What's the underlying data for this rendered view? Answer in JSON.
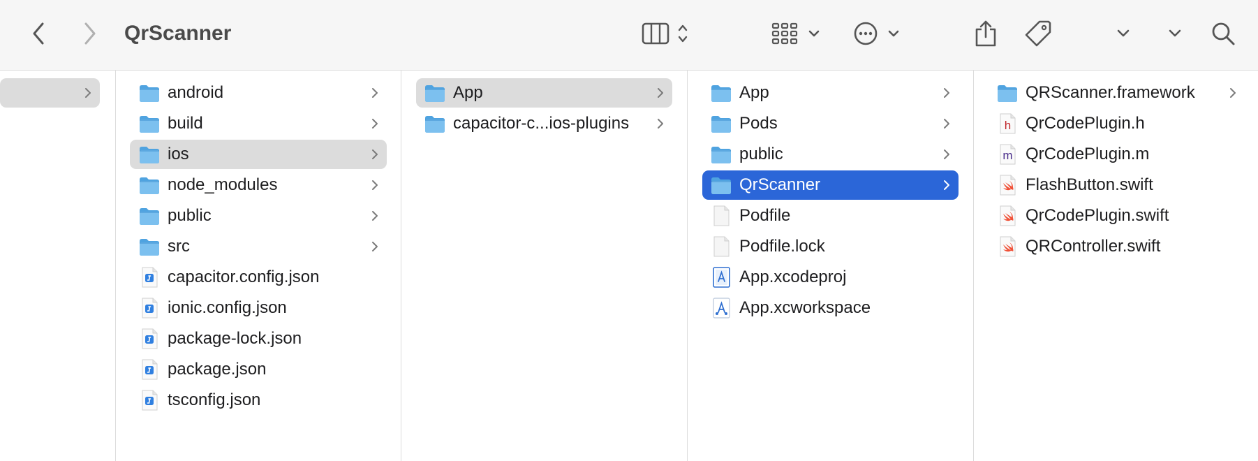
{
  "window": {
    "title": "QrScanner"
  },
  "toolbar": {
    "buttons": [
      {
        "name": "back-button",
        "icon": "chevron-left-icon"
      },
      {
        "name": "forward-button",
        "icon": "chevron-right-icon"
      },
      {
        "name": "view-columns-button",
        "icon": "columns-icon"
      },
      {
        "name": "group-button",
        "icon": "grid-icon"
      },
      {
        "name": "more-actions-button",
        "icon": "ellipsis-circle-icon"
      },
      {
        "name": "share-button",
        "icon": "share-icon"
      },
      {
        "name": "tags-button",
        "icon": "tag-icon"
      },
      {
        "name": "dropdown-button-1",
        "icon": "chevron-down-icon"
      },
      {
        "name": "dropdown-button-2",
        "icon": "chevron-down-icon"
      },
      {
        "name": "search-button",
        "icon": "search-icon"
      }
    ]
  },
  "columns": {
    "col0": {
      "items": [
        {
          "name": "",
          "icon": "none",
          "selected": "gray",
          "chevron": true
        }
      ]
    },
    "col1": {
      "items": [
        {
          "name": "android",
          "icon": "folder-icon",
          "chevron": true
        },
        {
          "name": "build",
          "icon": "folder-icon",
          "chevron": true
        },
        {
          "name": "ios",
          "icon": "folder-icon",
          "chevron": true,
          "selected": "gray"
        },
        {
          "name": "node_modules",
          "icon": "folder-icon",
          "chevron": true
        },
        {
          "name": "public",
          "icon": "folder-icon",
          "chevron": true
        },
        {
          "name": "src",
          "icon": "folder-icon",
          "chevron": true
        },
        {
          "name": "capacitor.config.json",
          "icon": "json-file-icon",
          "chevron": false
        },
        {
          "name": "ionic.config.json",
          "icon": "json-file-icon",
          "chevron": false
        },
        {
          "name": "package-lock.json",
          "icon": "json-file-icon",
          "chevron": false
        },
        {
          "name": "package.json",
          "icon": "json-file-icon",
          "chevron": false
        },
        {
          "name": "tsconfig.json",
          "icon": "json-file-icon",
          "chevron": false
        }
      ]
    },
    "col2": {
      "items": [
        {
          "name": "App",
          "icon": "folder-icon",
          "chevron": true,
          "selected": "gray"
        },
        {
          "name": "capacitor-c...ios-plugins",
          "icon": "folder-icon",
          "chevron": true
        }
      ]
    },
    "col3": {
      "items": [
        {
          "name": "App",
          "icon": "folder-icon",
          "chevron": true
        },
        {
          "name": "Pods",
          "icon": "folder-icon",
          "chevron": true
        },
        {
          "name": "public",
          "icon": "folder-icon",
          "chevron": true
        },
        {
          "name": "QrScanner",
          "icon": "folder-icon",
          "chevron": true,
          "selected": "blue"
        },
        {
          "name": "Podfile",
          "icon": "blank-file-icon",
          "chevron": false
        },
        {
          "name": "Podfile.lock",
          "icon": "blank-file-icon",
          "chevron": false
        },
        {
          "name": "App.xcodeproj",
          "icon": "xcodeproj-icon",
          "chevron": false
        },
        {
          "name": "App.xcworkspace",
          "icon": "xcworkspace-icon",
          "chevron": false
        }
      ]
    },
    "col4": {
      "items": [
        {
          "name": "QRScanner.framework",
          "icon": "folder-icon",
          "chevron": true
        },
        {
          "name": "QrCodePlugin.h",
          "icon": "header-file-icon",
          "chevron": false,
          "letter": "h"
        },
        {
          "name": "QrCodePlugin.m",
          "icon": "objc-file-icon",
          "chevron": false,
          "letter": "m"
        },
        {
          "name": "FlashButton.swift",
          "icon": "swift-file-icon",
          "chevron": false
        },
        {
          "name": "QrCodePlugin.swift",
          "icon": "swift-file-icon",
          "chevron": false
        },
        {
          "name": "QRController.swift",
          "icon": "swift-file-icon",
          "chevron": false
        }
      ]
    }
  },
  "colors": {
    "selection_blue": "#2b66d8",
    "selection_gray": "#dcdcdc",
    "folder_blue": "#5aaee8"
  }
}
